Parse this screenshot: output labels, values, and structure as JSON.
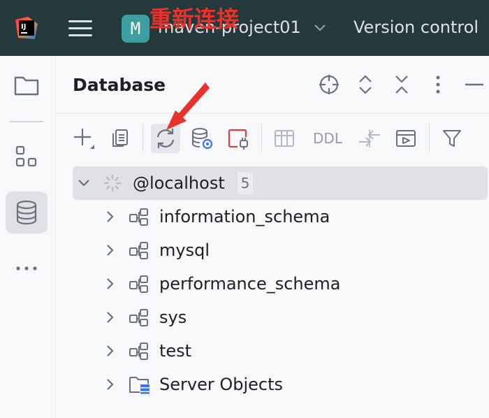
{
  "titlebar": {
    "logo_text": "IJ",
    "project_badge": "M",
    "project_name": "maven-project01",
    "vcs_label": "Version control"
  },
  "annotation": {
    "text": "重新连接",
    "color": "#e8322b"
  },
  "panel": {
    "title": "Database",
    "toolbar": {
      "ddl_label": "DDL"
    }
  },
  "tree": {
    "root": {
      "label": "@localhost",
      "count": "5",
      "expanded": true
    },
    "children": [
      {
        "label": "information_schema",
        "icon": "schema-icon"
      },
      {
        "label": "mysql",
        "icon": "schema-icon"
      },
      {
        "label": "performance_schema",
        "icon": "schema-icon"
      },
      {
        "label": "sys",
        "icon": "schema-icon"
      },
      {
        "label": "test",
        "icon": "schema-icon"
      },
      {
        "label": "Server Objects",
        "icon": "server-objects-folder-icon"
      }
    ]
  },
  "colors": {
    "titlebar_bg": "#25383b",
    "project_badge_bg": "#3e9fa3",
    "accent_blue": "#3574f0",
    "accent_red": "#db3b4b"
  }
}
